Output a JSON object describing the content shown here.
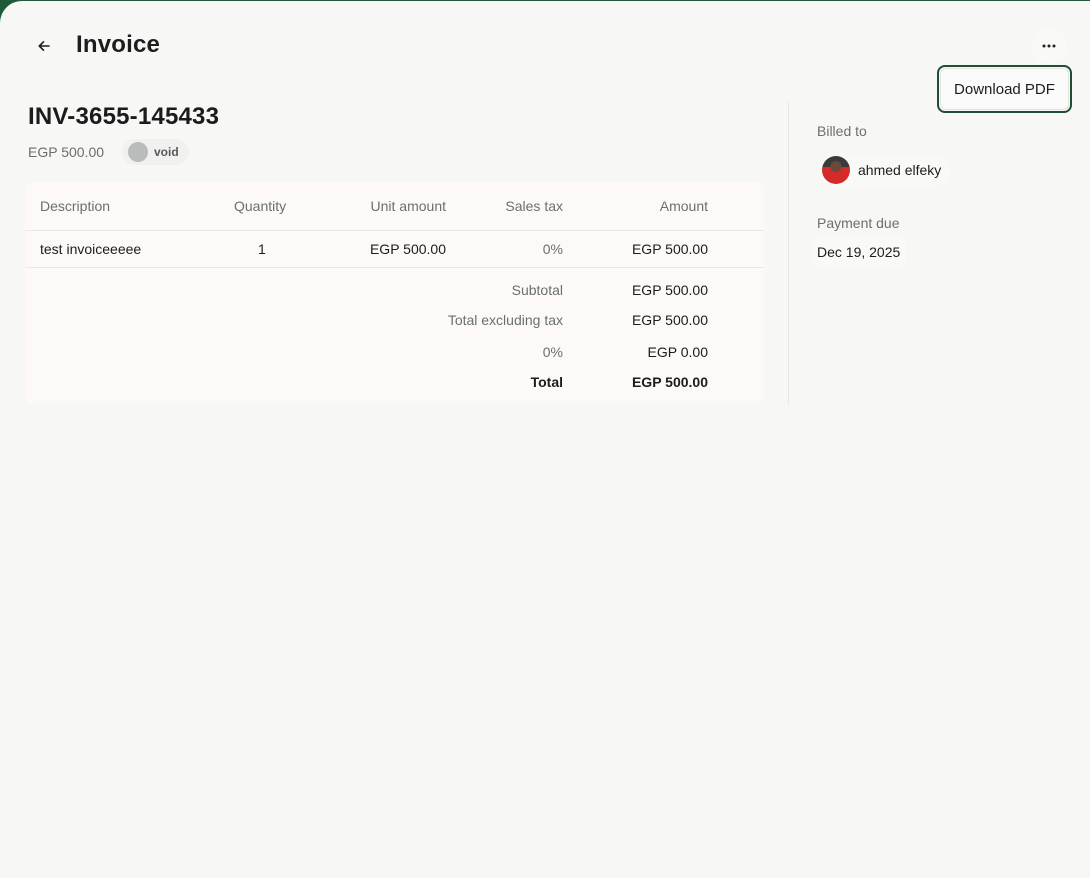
{
  "header": {
    "title": "Invoice",
    "download_label": "Download PDF"
  },
  "invoice": {
    "number": "INV-3655-145433",
    "amount": "EGP 500.00",
    "status": "void"
  },
  "table": {
    "columns": [
      "Description",
      "Quantity",
      "Unit amount",
      "Sales tax",
      "Amount"
    ],
    "items": [
      {
        "description": "test invoiceeeee",
        "quantity": "1",
        "unit_amount": "EGP 500.00",
        "sales_tax": "0%",
        "amount": "EGP 500.00"
      }
    ],
    "totals": [
      {
        "label": "Subtotal",
        "value": "EGP 500.00"
      },
      {
        "label": "Total excluding tax",
        "value": "EGP 500.00"
      },
      {
        "label": "0%",
        "value": "EGP 0.00"
      },
      {
        "label": "Total",
        "value": "EGP 500.00"
      }
    ]
  },
  "sidebar": {
    "billed_to_label": "Billed to",
    "customer_name": "ahmed elfeky",
    "payment_due_label": "Payment due",
    "payment_due_date": "Dec 19, 2025"
  },
  "icons": {
    "back": "arrow-left-icon",
    "more": "ellipsis-icon"
  },
  "colors": {
    "accent": "#1e4d34",
    "background": "#f7f7f6",
    "card": "#fdf9f8"
  }
}
